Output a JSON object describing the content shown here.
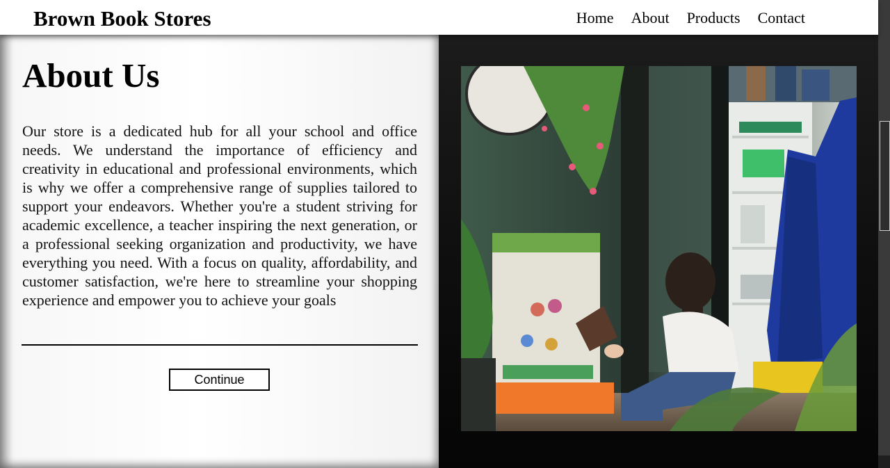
{
  "header": {
    "brand": "Brown Book Stores",
    "nav": [
      "Home",
      "About",
      "Products",
      "Contact"
    ]
  },
  "about": {
    "title": "About Us",
    "body": "Our store is a dedicated hub for all your school and office needs. We understand the importance of efficiency and creativity in educational and professional environments, which is why we offer a comprehensive range of supplies tailored to support your endeavors. Whether you're a student striving for academic excellence, a teacher inspiring the next generation, or a professional seeking organization and productivity, we have everything you need. With a focus on quality, affordability, and customer satisfaction, we're here to streamline your shopping experience and empower you to achieve your goals",
    "button_label": "Continue"
  },
  "colors": {
    "navbar_bg": "#ffffff",
    "right_panel_bg": "#0f0f0f",
    "text": "#000000"
  },
  "icons": {
    "photo": "bookstore-reader-photo"
  }
}
